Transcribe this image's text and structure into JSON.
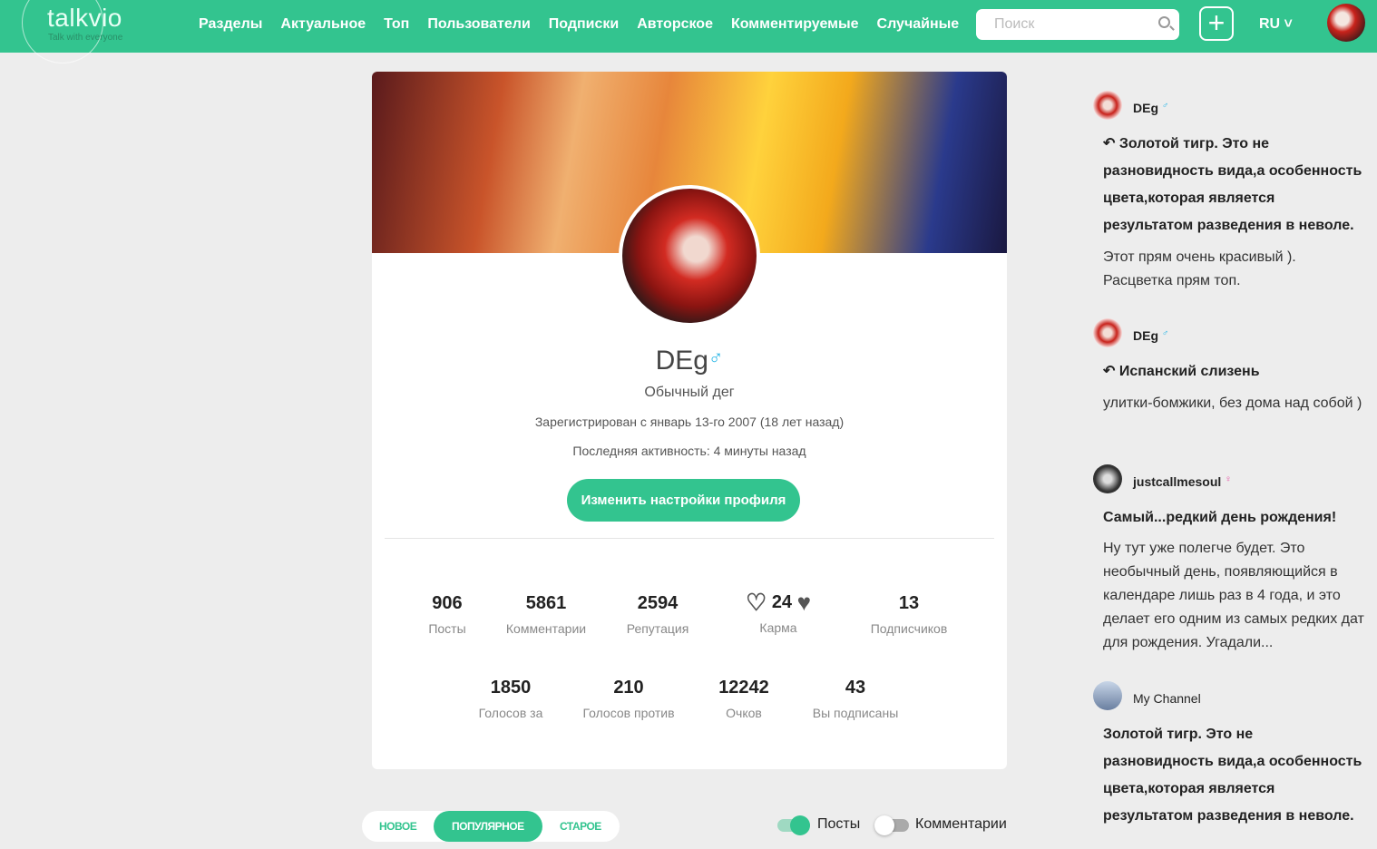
{
  "header": {
    "logo": "talkvio",
    "slogan": "Talk with everyone",
    "nav": [
      "Разделы",
      "Актуальное",
      "Топ",
      "Пользователи",
      "Подписки",
      "Авторское",
      "Комментируемые",
      "Случайные"
    ],
    "search_placeholder": "Поиск",
    "lang": "RU ˅"
  },
  "profile": {
    "name": "DEg",
    "gender": "♂",
    "status": "Обычный дег",
    "registered": "Зарегистрирован с январь 13-го 2007 (18 лет назад)",
    "last_active": "Последняя активность: 4 минуты назад",
    "edit_button": "Изменить настройки профиля",
    "stats": [
      {
        "value": "906",
        "label": "Посты"
      },
      {
        "value": "5861",
        "label": "Комментарии"
      },
      {
        "value": "2594",
        "label": "Репутация"
      },
      {
        "value": "24",
        "label": "Карма"
      },
      {
        "value": "13",
        "label": "Подписчиков"
      },
      {
        "value": "1850",
        "label": "Голосов за"
      },
      {
        "value": "210",
        "label": "Голосов против"
      },
      {
        "value": "12242",
        "label": "Очков"
      },
      {
        "value": "43",
        "label": "Вы подписаны"
      }
    ]
  },
  "sort_tabs": [
    "НОВОЕ",
    "ПОПУЛЯРНОЕ",
    "СТАРОЕ"
  ],
  "toggles": {
    "posts": "Посты",
    "posts_on": true,
    "comments": "Комментарии",
    "comments_on": false
  },
  "feed": [
    {
      "user": "DEg",
      "gender": "♂",
      "title": "Золотой тигр. Это не разновидность вида,а особенность цвета,которая является результатом разведения в неволе.",
      "text": "Этот прям очень красивый ). Расцветка прям топ."
    },
    {
      "user": "DEg",
      "gender": "♂",
      "title": "Испанский слизень",
      "text": "улитки-бомжики, без дома над собой )"
    },
    {
      "user": "justcallmesoul",
      "gender": "♀",
      "title": "Самый...редкий день рождения!",
      "text": "Ну тут уже полегче будет. Это необычный день, появляющийся в календаре лишь раз в 4 года, и это делает его одним из самых редких дат для рождения. Угадали..."
    },
    {
      "user": "My Channel",
      "gender": "",
      "title": "Золотой тигр. Это не разновидность вида,а особенность цвета,которая является результатом разведения в неволе.",
      "text": ""
    }
  ],
  "colors": {
    "accent": "#33c48f",
    "male": "#29b6e6",
    "female": "#e64aa0"
  }
}
